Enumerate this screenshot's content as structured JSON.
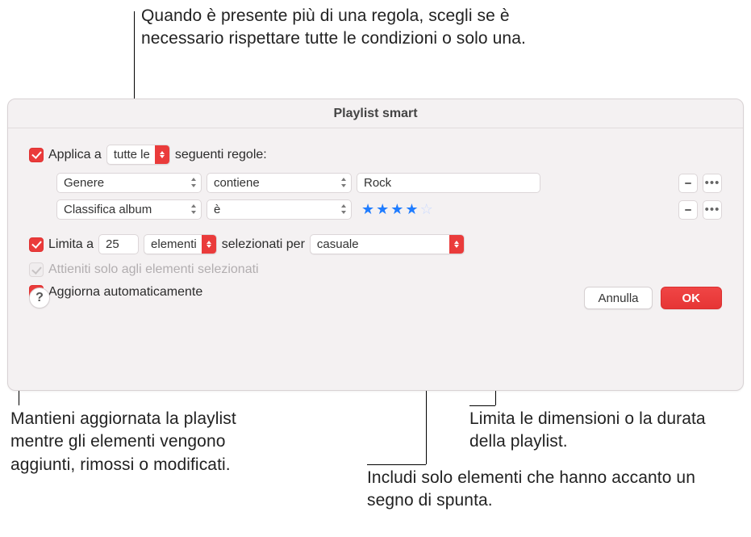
{
  "annotations": {
    "match_rules": "Quando è presente più di una regola, scegli se è necessario rispettare tutte le condizioni o solo una.",
    "limit_size": "Limita le dimensioni o la durata della playlist.",
    "only_checked": "Includi solo elementi che hanno accanto un segno di spunta.",
    "live_update": "Mantieni aggiornata la playlist mentre gli elementi vengono aggiunti, rimossi o modificati."
  },
  "dialog": {
    "title": "Playlist smart",
    "apply": {
      "prefix": "Applica a",
      "match_mode": "tutte le",
      "suffix": "seguenti regole:"
    },
    "rules": [
      {
        "field": "Genere",
        "op": "contiene",
        "value": "Rock"
      },
      {
        "field": "Classifica album",
        "op": "è",
        "stars": 4,
        "max_stars": 5
      }
    ],
    "limit": {
      "label": "Limita a",
      "value": "25",
      "unit": "elementi",
      "selected_by_label": "selezionati per",
      "selected_by_value": "casuale"
    },
    "only_checked_label": "Attieniti solo agli elementi selezionati",
    "live_update_label": "Aggiorna automaticamente",
    "buttons": {
      "help": "?",
      "cancel": "Annulla",
      "ok": "OK"
    }
  }
}
